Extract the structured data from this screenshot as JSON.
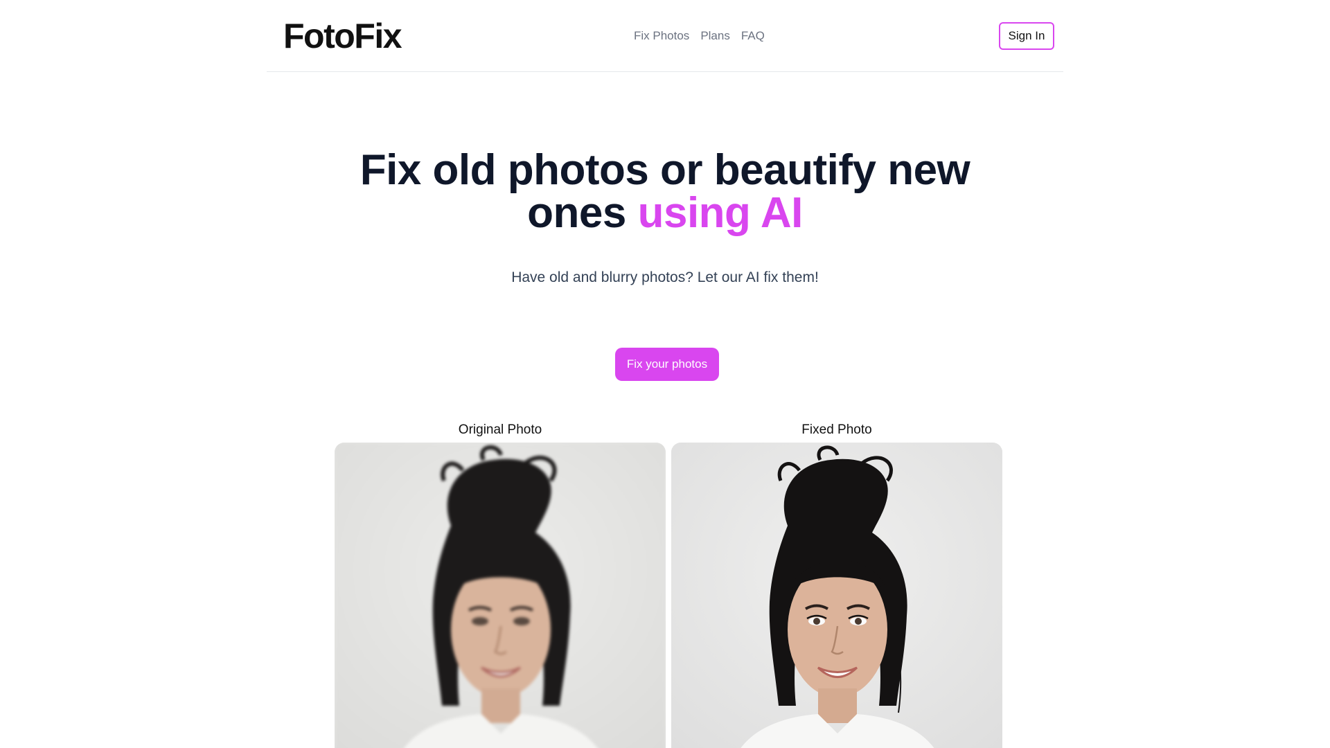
{
  "header": {
    "logo": "FotoFix",
    "nav": [
      "Fix Photos",
      "Plans",
      "FAQ"
    ],
    "sign_in_label": "Sign In"
  },
  "hero": {
    "title_part1": "Fix old photos or beautify new ones ",
    "title_accent": "using AI",
    "subtitle": "Have old and blurry photos? Let our AI fix them!",
    "cta_label": "Fix your photos"
  },
  "comparison": {
    "original_label": "Original Photo",
    "fixed_label": "Fixed Photo",
    "original_image": "portrait-blurry-woman-photo",
    "fixed_image": "portrait-sharp-woman-photo"
  },
  "colors": {
    "accent": "#d946ef",
    "heading": "#0f172a",
    "nav_text": "#6b7280",
    "divider": "#e5e7eb"
  }
}
